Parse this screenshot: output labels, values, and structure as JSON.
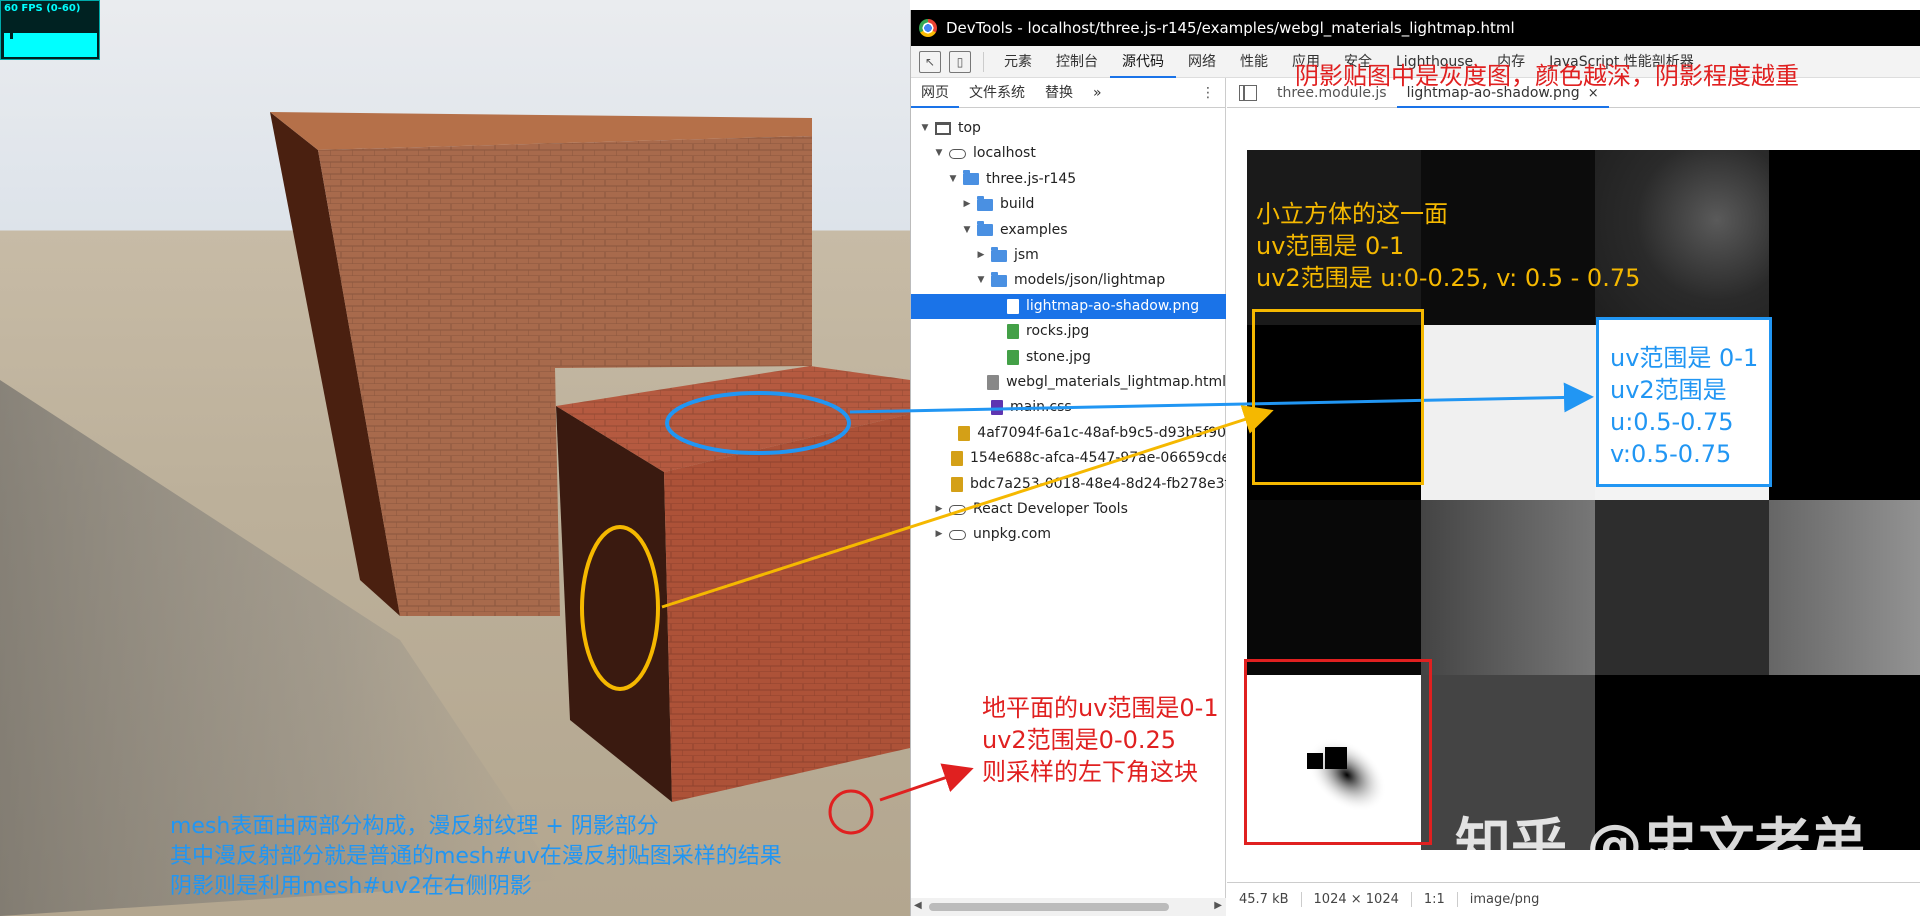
{
  "stats": {
    "fps_label": "60 FPS (0-60)"
  },
  "devtools": {
    "window_title": "DevTools - localhost/three.js-r145/examples/webgl_materials_lightmap.html",
    "toolbar": {
      "inspect_icon": "inspect-element-icon",
      "device_icon": "device-toggle-icon",
      "tabs": [
        "元素",
        "控制台",
        "源代码",
        "网络",
        "性能",
        "应用",
        "安全",
        "Lighthouse",
        "内存",
        "JavaScript 性能剖析器"
      ],
      "active_tab": "源代码"
    },
    "navigator": {
      "tabs": [
        "网页",
        "文件系统",
        "替换"
      ],
      "more": "»",
      "menu": "⋮",
      "tree": [
        {
          "label": "top",
          "icon": "frame-icon",
          "expanded": true,
          "depth": 0
        },
        {
          "label": "localhost",
          "icon": "cloud-icon",
          "expanded": true,
          "depth": 1
        },
        {
          "label": "three.js-r145",
          "icon": "folder-icon",
          "expanded": true,
          "depth": 2
        },
        {
          "label": "build",
          "icon": "folder-icon",
          "expanded": false,
          "depth": 3
        },
        {
          "label": "examples",
          "icon": "folder-icon",
          "expanded": true,
          "depth": 3
        },
        {
          "label": "jsm",
          "icon": "folder-icon",
          "expanded": false,
          "depth": 4
        },
        {
          "label": "models/json/lightmap",
          "icon": "folder-icon",
          "expanded": true,
          "depth": 4
        },
        {
          "label": "lightmap-ao-shadow.png",
          "icon": "file-icon",
          "depth": 5,
          "selected": true
        },
        {
          "label": "rocks.jpg",
          "icon": "image-file-icon",
          "depth": 5
        },
        {
          "label": "stone.jpg",
          "icon": "image-file-icon",
          "depth": 5
        },
        {
          "label": "webgl_materials_lightmap.html",
          "icon": "html-file-icon",
          "depth": 4
        },
        {
          "label": "main.css",
          "icon": "css-file-icon",
          "depth": 4
        },
        {
          "label": "4af7094f-6a1c-48af-b9c5-d93b5f90",
          "icon": "script-file-icon",
          "depth": 2
        },
        {
          "label": "154e688c-afca-4547-97ae-06659cde",
          "icon": "script-file-icon",
          "depth": 2
        },
        {
          "label": "bdc7a253-0018-48e4-8d24-fb278e3f",
          "icon": "script-file-icon",
          "depth": 2
        },
        {
          "label": "React Developer Tools",
          "icon": "cloud-icon",
          "expanded": false,
          "depth": 1
        },
        {
          "label": "unpkg.com",
          "icon": "cloud-icon",
          "expanded": false,
          "depth": 1
        }
      ]
    },
    "editor": {
      "tabs": [
        "three.module.js",
        "lightmap-ao-shadow.png"
      ],
      "active_tab": "lightmap-ao-shadow.png",
      "close": "×",
      "status": {
        "size": "45.7 kB",
        "dimensions": "1024 × 1024",
        "zoom": "1:1",
        "mime": "image/png"
      }
    }
  },
  "lightmap_cells": [
    "#1a1a1a",
    "#0c0c0c",
    "#2a2a2a",
    "#000000",
    "#000000",
    "#f0f0f0",
    "#f3f3f3",
    "#000000",
    "#080808",
    "#6e6e6e",
    "#2d2d2d",
    "#8a8a8a",
    "#ffffff",
    "#444444",
    "#000000",
    "#000000"
  ],
  "annotations": {
    "title_red": "阴影贴图中是灰度图，颜色越深，阴影程度越重",
    "small_cube": [
      "小立方体的这一面",
      "uv范围是 0-1",
      "uv2范围是 u:0-0.25, v: 0.5 - 0.75"
    ],
    "top_face": [
      "uv范围是 0-1",
      "uv2范围是",
      "u:0.5-0.75",
      "v:0.5-0.75"
    ],
    "ground": [
      "地平面的uv范围是0-1",
      "uv2范围是0-0.25",
      "则采样的左下角这块"
    ],
    "mesh": [
      "mesh表面由两部分构成，漫反射纹理 + 阴影部分",
      "其中漫反射部分就是普通的mesh#uv在漫反射贴图采样的结果",
      "阴影则是利用mesh#uv2在右侧阴影"
    ],
    "watermark": "知乎 @忠文老弟",
    "colors": {
      "red": "#e02020",
      "orange": "#f5b800",
      "blue": "#2196f3",
      "mesh_text": "#2196f3",
      "ground_text": "#e02020"
    }
  }
}
